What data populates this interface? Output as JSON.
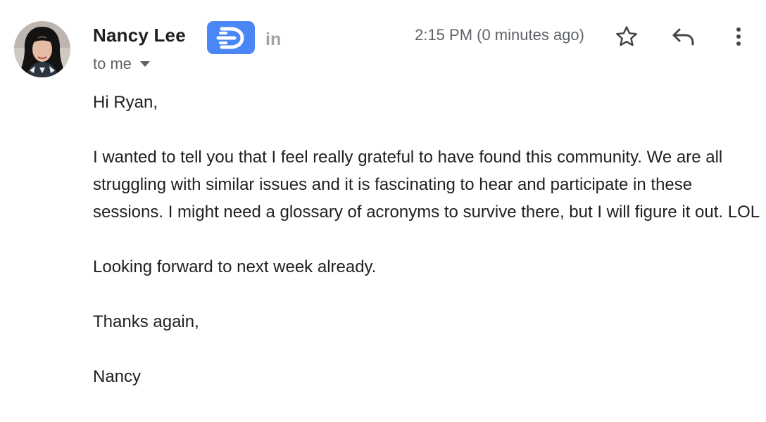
{
  "header": {
    "sender_name": "Nancy Lee",
    "recipient_label": "to me",
    "timestamp": "2:15 PM (0 minutes ago)",
    "linkedin_label": "in",
    "ext_badge_letter": "D",
    "ext_badge_color": "#4a86f5"
  },
  "actions": {
    "star_icon": "star-outline-icon",
    "reply_icon": "reply-arrow-icon",
    "more_icon": "vertical-dots-icon"
  },
  "message": {
    "greeting": "Hi Ryan,",
    "paragraph_1": "I wanted to tell you that I feel really grateful to have found this community. We are all struggling with similar issues and it is fascinating to hear and participate in these sessions. I might need a glossary of acronyms to survive there, but I will figure it out. LOL",
    "paragraph_2": "Looking forward to next week already.",
    "closing": "Thanks again,",
    "signature": "Nancy"
  }
}
